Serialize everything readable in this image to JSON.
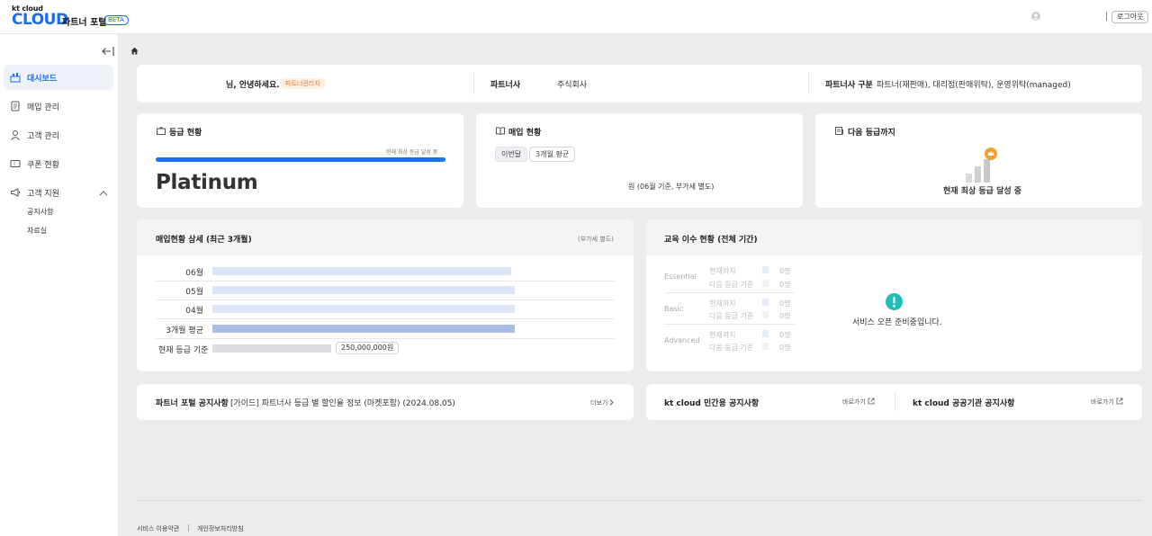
{
  "header": {
    "logo_small": "kt cloud",
    "logo_main": "CLOUD",
    "portal_name": "파트너 포털",
    "beta": "BETA",
    "logout": "로그아웃"
  },
  "sidebar": {
    "items": [
      {
        "label": "대시보드",
        "icon": "dashboard-icon"
      },
      {
        "label": "매입 관리",
        "icon": "document-icon"
      },
      {
        "label": "고객 관리",
        "icon": "user-icon"
      },
      {
        "label": "쿠폰 현황",
        "icon": "coupon-icon"
      },
      {
        "label": "고객 지원",
        "icon": "megaphone-icon"
      }
    ],
    "sub_items": [
      "공지사항",
      "자료실"
    ]
  },
  "greeting": {
    "text": "님, 안녕하세요.",
    "role_badge": "파트너관리자",
    "partner_label": "파트너사",
    "partner_value": "주식회사",
    "type_label": "파트너사 구분",
    "type_value": "파트너(재판매), 대리점(판매위탁), 운영위탁(managed)"
  },
  "grade": {
    "title": "등급 현황",
    "status": "현재 최상 등급 달성 중",
    "tier": "Platinum",
    "progress_fraction": 1.0
  },
  "purchase": {
    "title": "매입 현황",
    "tab_selected": "이번달",
    "tab_other": "3개월 평균",
    "note": "원 (06월 기준, 부가세 별도)"
  },
  "next_grade": {
    "title": "다음 등급까지",
    "status": "현재 최상 등급 달성 중"
  },
  "purchase_detail": {
    "title": "매입현황 상세 (최근 3개월)",
    "vat_note": "(부가세 별도)",
    "rows": [
      {
        "label": "06월",
        "fraction": 0.99
      },
      {
        "label": "05월",
        "fraction": 1.0
      },
      {
        "label": "04월",
        "fraction": 1.0
      },
      {
        "label": "3개월 평균",
        "fraction": 1.0
      }
    ],
    "baseline_label": "현재 등급 기준",
    "baseline_amount": "250,000,000원"
  },
  "education": {
    "title": "교육 이수 현황 (전체 기간)",
    "categories": [
      "Essential",
      "Basic",
      "Advanced"
    ],
    "row_current": "현재까지",
    "row_next": "다음 등급 기준",
    "value": "0명",
    "notice": "서비스 오픈 준비중입니다."
  },
  "notices": {
    "portal_title": "파트너 포털 공지사항",
    "portal_item": "[가이드] 파트너사 등급 별 할인율 정보 (마켓포함) (2024.08.05)",
    "more": "더보기",
    "private_title": "kt cloud 민간용 공지사항",
    "public_title": "kt cloud 공공기관 공지사항",
    "goto": "바로가기"
  },
  "footer": {
    "terms": "서비스 이용약관",
    "privacy": "개인정보처리방침"
  },
  "colors": {
    "accent": "#1a73e8",
    "bar_light": "#dde6f7",
    "bar_avg": "#a8bee6",
    "teal": "#1fbfb8",
    "badge_orange": "#e07b2c"
  }
}
